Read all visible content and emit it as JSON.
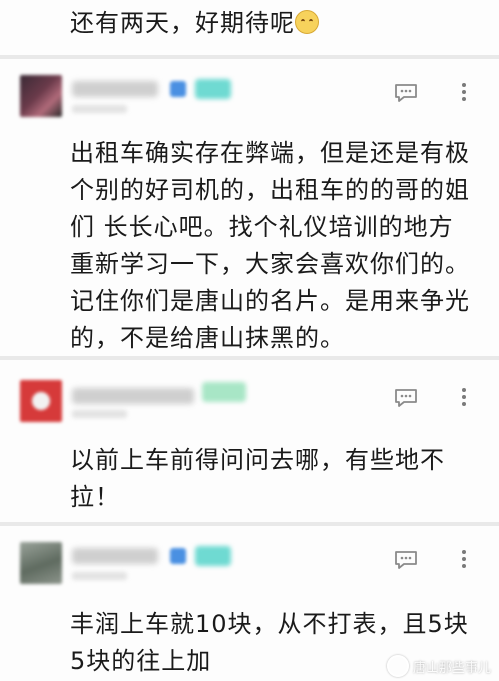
{
  "top_comment": {
    "text": "还有两天，好期待呢",
    "emoji": "smiling-face-emoji"
  },
  "comments": [
    {
      "text": "出租车确实存在弊端，但是还是有极个别的好司机的，出租车的的哥的姐们 长长心吧。找个礼仪培训的地方重新学习一下，大家会喜欢你们的。记住你们是唐山的名片。是用来争光的，不是给唐山抹黑的。"
    },
    {
      "text": "以前上车前得问问去哪，有些地不拉！"
    },
    {
      "text": "丰润上车就10块，从不打表，且5块5块的往上加"
    }
  ],
  "icons": {
    "reply": "comment-bubble-icon",
    "more": "more-vertical-icon"
  },
  "colors": {
    "avatar1": "#6a3a4a",
    "avatar2": "#d63a3a",
    "avatar3": "#7a8a7a",
    "badge_blue": "#4a90e2",
    "badge_teal": "#6fdad2"
  },
  "watermark": {
    "text": "唐山那些事儿"
  }
}
